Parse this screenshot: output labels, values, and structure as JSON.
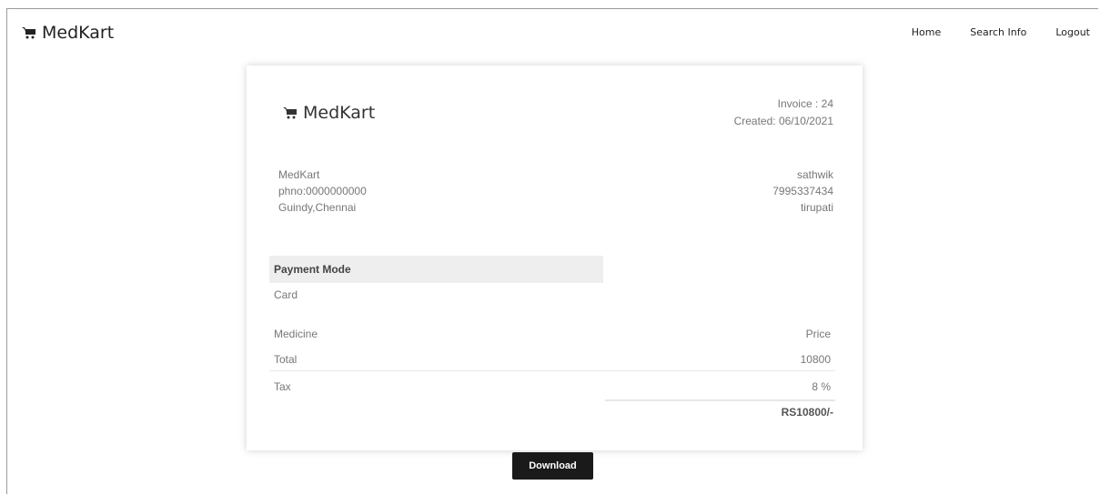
{
  "navbar": {
    "brand": "MedKart",
    "links": [
      "Home",
      "Search Info",
      "Logout"
    ]
  },
  "invoice": {
    "brand": "MedKart",
    "number": "Invoice : 24",
    "created": "Created: 06/10/2021",
    "from": {
      "name": "MedKart",
      "phone": "phno:0000000000",
      "address": "Guindy,Chennai"
    },
    "to": {
      "name": "sathwik",
      "phone": "7995337434",
      "address": "tirupati"
    },
    "payment_mode_label": "Payment Mode",
    "payment_mode_value": "Card",
    "header_row": {
      "left": "Medicine",
      "right": "Price"
    },
    "total_row": {
      "left": "Total",
      "right": "10800"
    },
    "tax_row": {
      "left": "Tax",
      "right": "8 %"
    },
    "grand_total": "RS10800/-"
  },
  "download_label": "Download"
}
